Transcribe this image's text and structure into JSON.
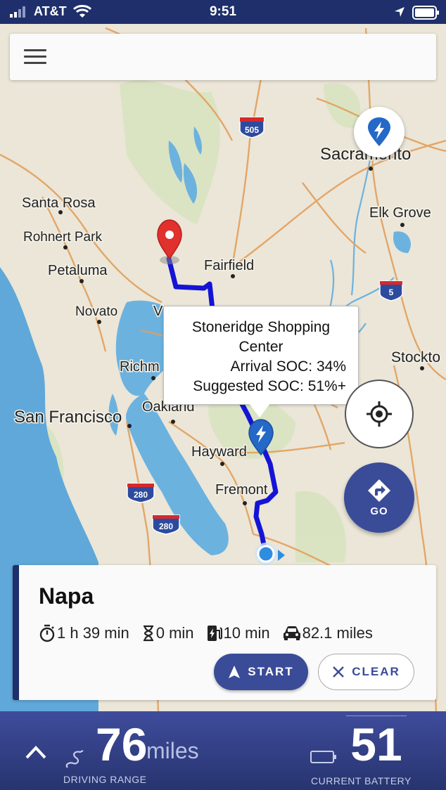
{
  "status_bar": {
    "carrier": "AT&T",
    "time": "9:51"
  },
  "map": {
    "labels": [
      "Santa Rosa",
      "Rohnert Park",
      "Petaluma",
      "Novato",
      "San Francisco",
      "Fairfield",
      "Sacramento",
      "Elk Grove",
      "Stockto",
      "Hayward",
      "Fremont",
      "Richm",
      "Oakland",
      "V"
    ],
    "highways": [
      "505",
      "5",
      "280",
      "280"
    ],
    "colors": {
      "water": "#5fa8d9",
      "land": "#ebe6d8",
      "park": "#c9dfb4",
      "road": "#e3a05b",
      "route": "#1414d6",
      "pin": "#e0312d"
    }
  },
  "callout": {
    "title_line1": "Stoneridge Shopping",
    "title_line2": "Center",
    "arrival": "Arrival SOC: 34%",
    "suggested": "Suggested SOC: 51%+"
  },
  "go_button": {
    "label": "GO"
  },
  "route_card": {
    "destination": "Napa",
    "drive_time": "1 h 39 min",
    "wait_time": "0 min",
    "charge_time": "10 min",
    "distance": "82.1 miles",
    "start_label": "START",
    "clear_label": "CLEAR"
  },
  "bottom_bar": {
    "range_value": "76",
    "range_unit": "miles",
    "range_label": "DRIVING RANGE",
    "battery_value": "51",
    "battery_label": "CURRENT BATTERY"
  },
  "accent": "#3a4b98"
}
